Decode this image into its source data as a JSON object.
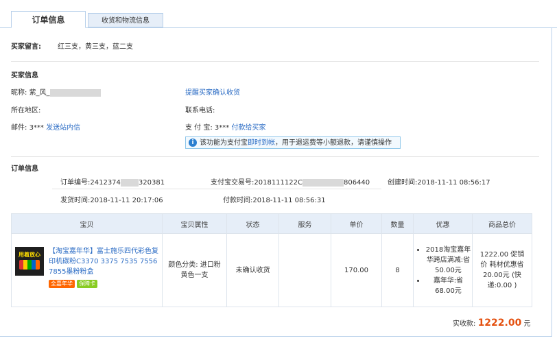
{
  "tabs": {
    "order_info": "订单信息",
    "shipping_info": "收货和物流信息"
  },
  "buyer_message": {
    "label": "买家留言:",
    "value": "红三支，黄三支，蓝二支"
  },
  "buyer_info": {
    "title": "买家信息",
    "nickname_label": "昵称:",
    "nickname_value": "紫_风_",
    "remind_link": "提醒买家确认收货",
    "region_label": "所在地区:",
    "phone_label": "联系电话:",
    "email_label": "邮件:",
    "email_value": "3***",
    "email_link": "发送站内信",
    "alipay_label": "支 付 宝:",
    "alipay_value": "3***",
    "alipay_link": "付款给买家",
    "notice_pre": "该功能为支付宝",
    "notice_link": "即时到帐",
    "notice_post": "，用于退运费等小额退款，请谨慎操作"
  },
  "order_info": {
    "title": "订单信息",
    "order_no_label": "订单编号:",
    "order_no_pre": "2412374",
    "order_no_post": "320381",
    "trade_no_label": "支付宝交易号:",
    "trade_no_pre": "2018111122C",
    "trade_no_post": "806440",
    "created_label": "创建时间:",
    "created_value": "2018-11-11 08:56:17",
    "shipped_label": "发货时间:",
    "shipped_value": "2018-11-11 20:17:06",
    "paid_label": "付款时间:",
    "paid_value": "2018-11-11 08:56:31"
  },
  "table": {
    "headers": [
      "宝贝",
      "宝贝属性",
      "状态",
      "服务",
      "单价",
      "数量",
      "优惠",
      "商品总价"
    ],
    "item": {
      "thumb_text": "用着放心",
      "title": "【淘宝嘉年华】富士施乐四代彩色复印机碳粉C3370 3375 7535 7556 7855墨粉粉盒",
      "badge1": "全嘉年华",
      "badge2": "保障卡",
      "attributes": "颜色分类: 进口粉黄色一支",
      "status": "未确认收货",
      "service": "",
      "price": "170.00",
      "quantity": "8",
      "promotions": [
        "2018淘宝嘉年华跨店满减:省 50.00元",
        "嘉年华:省 68.00元"
      ],
      "total_lines": "1222.00 促销价 耗材优惠省20.00元 (快递:0.00 )"
    }
  },
  "summary": {
    "label": "实收款:",
    "amount": "1222.00",
    "unit": "元"
  }
}
